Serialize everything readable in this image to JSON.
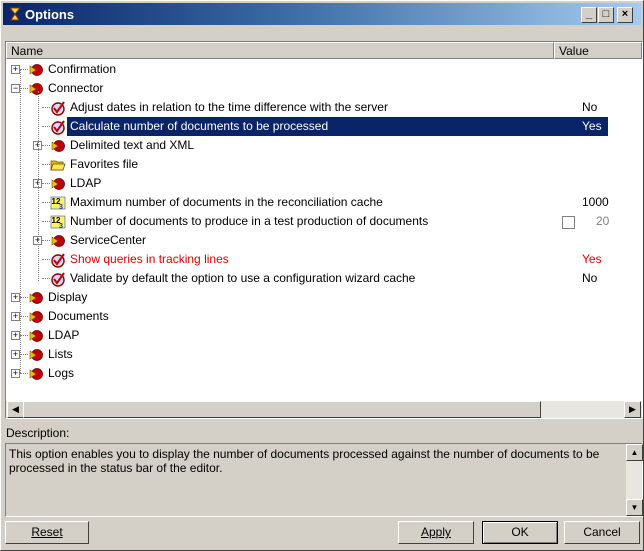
{
  "window": {
    "title": "Options"
  },
  "columns": {
    "name": "Name",
    "value": "Value"
  },
  "tree": [
    {
      "label": "Confirmation",
      "level": 0,
      "icon": "folder-node-icon",
      "expander": "+"
    },
    {
      "label": "Connector",
      "level": 0,
      "icon": "folder-node-icon",
      "expander": "−"
    },
    {
      "label": "Adjust dates in relation to the time difference with the server",
      "level": 1,
      "icon": "option-check-icon",
      "value": "No"
    },
    {
      "label": "Calculate number of documents to be processed",
      "level": 1,
      "icon": "option-check-icon",
      "value": "Yes",
      "selected": true
    },
    {
      "label": "Delimited text and XML",
      "level": 1,
      "icon": "folder-node-icon",
      "expander": "+"
    },
    {
      "label": "Favorites file",
      "level": 1,
      "icon": "open-folder-icon"
    },
    {
      "label": "LDAP",
      "level": 1,
      "icon": "folder-node-icon",
      "expander": "+"
    },
    {
      "label": "Maximum number of documents in the reconciliation cache",
      "level": 1,
      "icon": "number-icon",
      "value": "1000"
    },
    {
      "label": "Number of documents to produce in a test production of documents",
      "level": 1,
      "icon": "number-icon",
      "value": "20",
      "checkbox": true
    },
    {
      "label": "ServiceCenter",
      "level": 1,
      "icon": "folder-node-icon",
      "expander": "+"
    },
    {
      "label": "Show queries in tracking lines",
      "level": 1,
      "icon": "option-check-icon",
      "value": "Yes",
      "red": true
    },
    {
      "label": "Validate by default the option to use a configuration wizard cache",
      "level": 1,
      "icon": "option-check-icon",
      "value": "No"
    },
    {
      "label": "Display",
      "level": 0,
      "icon": "folder-node-icon",
      "expander": "+"
    },
    {
      "label": "Documents",
      "level": 0,
      "icon": "folder-node-icon",
      "expander": "+"
    },
    {
      "label": "LDAP",
      "level": 0,
      "icon": "folder-node-icon",
      "expander": "+"
    },
    {
      "label": "Lists",
      "level": 0,
      "icon": "folder-node-icon",
      "expander": "+"
    },
    {
      "label": "Logs",
      "level": 0,
      "icon": "folder-node-icon",
      "expander": "+"
    }
  ],
  "description": {
    "label": "Description:",
    "text": "This option enables you to display the number of documents processed against the number of documents to be processed in the status bar of the editor."
  },
  "buttons": {
    "reset": "Reset",
    "apply": "Apply",
    "ok": "OK",
    "cancel": "Cancel"
  },
  "colors": {
    "selection": "#0a246a",
    "highlight_text": "#e00000"
  }
}
